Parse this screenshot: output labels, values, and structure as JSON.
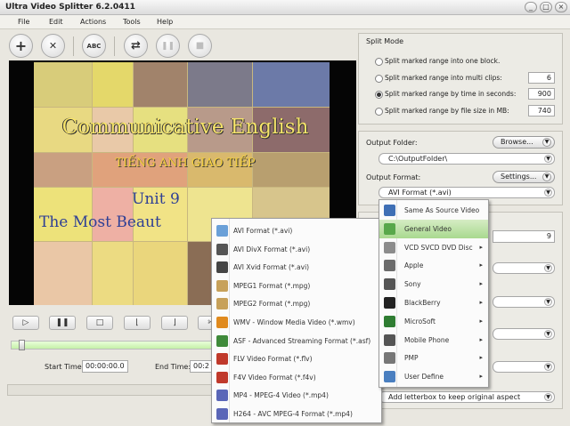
{
  "title": "Ultra Video Splitter 6.2.0411",
  "window_buttons": [
    "_",
    "□",
    "×"
  ],
  "menu": [
    "File",
    "Edit",
    "Actions",
    "Tools",
    "Help"
  ],
  "toolbar": {
    "add": "+",
    "remove": "✕",
    "abc": "ABC",
    "convert": "⇄",
    "pause": "❚❚",
    "stop": "■"
  },
  "video": {
    "line1": "Communicative English",
    "line2": "TIẾNG ANH GIAO TIẾP",
    "line3": "Unit 9",
    "line4": "The Most Beaut"
  },
  "controls": {
    "start_label": "Start Time:",
    "start_value": "00:00:00.0",
    "end_label": "End Time:",
    "end_value": "00:2"
  },
  "split_mode": {
    "title": "Split Mode",
    "options": [
      {
        "label": "Split  marked range into one block.",
        "value": ""
      },
      {
        "label": "Split  marked range into multi clips:",
        "value": "6"
      },
      {
        "label": "Split marked range by time in seconds:",
        "value": "900"
      },
      {
        "label": "Split marked range by file size in MB:",
        "value": "740"
      }
    ],
    "selected_index": 2
  },
  "output": {
    "folder_label": "Output Folder:",
    "browse_label": "Browse...",
    "folder_value": "C:\\OutputFolder\\",
    "format_label": "Output Format:",
    "settings_label": "Settings...",
    "format_value": "AVI Format (*.avi)",
    "partial_value": "9",
    "letterbox_value": "Add letterbox to keep original aspect"
  },
  "category_menu": {
    "items": [
      {
        "label": "Same As Source Video",
        "icon": "film-icon",
        "color": "#3f6fb5",
        "submenu": false
      },
      {
        "label": "General Video",
        "icon": "film-green-icon",
        "color": "#58a84a",
        "submenu": false
      },
      {
        "label": "VCD SVCD DVD Disc",
        "icon": "disc-icon",
        "color": "#8c8c8c",
        "submenu": true
      },
      {
        "label": "Apple",
        "icon": "apple-icon",
        "color": "#6b6b6b",
        "submenu": true
      },
      {
        "label": "Sony",
        "icon": "sony-icon",
        "color": "#555555",
        "submenu": true
      },
      {
        "label": "BlackBerry",
        "icon": "blackberry-icon",
        "color": "#222222",
        "submenu": true
      },
      {
        "label": "MicroSoft",
        "icon": "microsoft-icon",
        "color": "#2f7d32",
        "submenu": true
      },
      {
        "label": "Mobile Phone",
        "icon": "mobile-icon",
        "color": "#555555",
        "submenu": true
      },
      {
        "label": "PMP",
        "icon": "pmp-icon",
        "color": "#777777",
        "submenu": true
      },
      {
        "label": "User Define",
        "icon": "user-icon",
        "color": "#4a7fc0",
        "submenu": true
      }
    ],
    "highlighted_index": 1
  },
  "format_menu": {
    "items": [
      {
        "label": "AVI Format (*.avi)",
        "icon": "avi-icon",
        "color": "#6aa0d8"
      },
      {
        "label": "AVI DivX Format (*.avi)",
        "icon": "divx-icon",
        "color": "#555555"
      },
      {
        "label": "AVI Xvid Format (*.avi)",
        "icon": "xvid-icon",
        "color": "#444444"
      },
      {
        "label": "MPEG1 Format (*.mpg)",
        "icon": "mpeg1-icon",
        "color": "#c7a15a"
      },
      {
        "label": "MPEG2 Format (*.mpg)",
        "icon": "mpeg2-icon",
        "color": "#c7a15a"
      },
      {
        "label": "WMV - Window Media Video (*.wmv)",
        "icon": "wmv-icon",
        "color": "#e08a1e"
      },
      {
        "label": "ASF - Advanced Streaming Format (*.asf)",
        "icon": "asf-icon",
        "color": "#3f8a3a"
      },
      {
        "label": "FLV Video Format (*.flv)",
        "icon": "flv-icon",
        "color": "#c0392b"
      },
      {
        "label": "F4V Video Format (*.f4v)",
        "icon": "f4v-icon",
        "color": "#c0392b"
      },
      {
        "label": "MP4 - MPEG-4 Video (*.mp4)",
        "icon": "mp4-icon",
        "color": "#5a66b8"
      },
      {
        "label": "H264 - AVC MPEG-4 Format (*.mp4)",
        "icon": "h264-icon",
        "color": "#5a66b8"
      }
    ]
  }
}
